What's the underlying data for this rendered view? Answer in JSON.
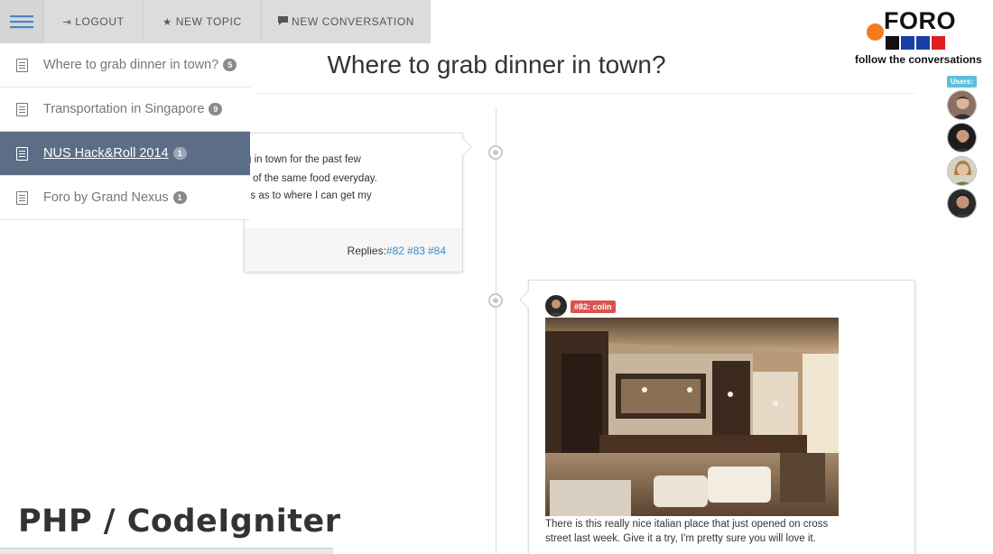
{
  "toolbar": {
    "menu_icon": "hamburger-icon",
    "logout_label": "LOGOUT",
    "new_topic_label": "NEW TOPIC",
    "new_conversation_label": "NEW CONVERSATION"
  },
  "sidebar": {
    "items": [
      {
        "label": "Where to grab dinner in town?",
        "count": "5",
        "active": false
      },
      {
        "label": "Transportation in Singapore",
        "count": "9",
        "active": false
      },
      {
        "label": "NUS Hack&Roll 2014",
        "count": "1",
        "active": true
      },
      {
        "label": "Foro by Grand Nexus",
        "count": "1",
        "active": false
      }
    ]
  },
  "page": {
    "title": "Where to grab dinner in town?"
  },
  "logo": {
    "name": "FORO",
    "tagline": "follow the conversations"
  },
  "users": {
    "label": "Users:"
  },
  "post_first": {
    "lines": [
      "g in town for the past few",
      "k of the same food everyday.",
      "ns as to where I can get my"
    ],
    "replies_label": "Replies:",
    "reply_links": [
      "#82",
      "#83",
      "#84"
    ]
  },
  "post_second": {
    "author_tag": "#82: colin",
    "text": "There is this really nice italian place that just opened on cross street last week. Give it a try, I'm pretty sure you will love it."
  },
  "overlay": {
    "caption": "PHP / CodeIgniter"
  },
  "colors": {
    "accent": "#5b6e86",
    "link": "#3a8bc8",
    "tag_red": "#d9534f",
    "users_label": "#5bc0de",
    "logo_orange": "#f47a20"
  }
}
